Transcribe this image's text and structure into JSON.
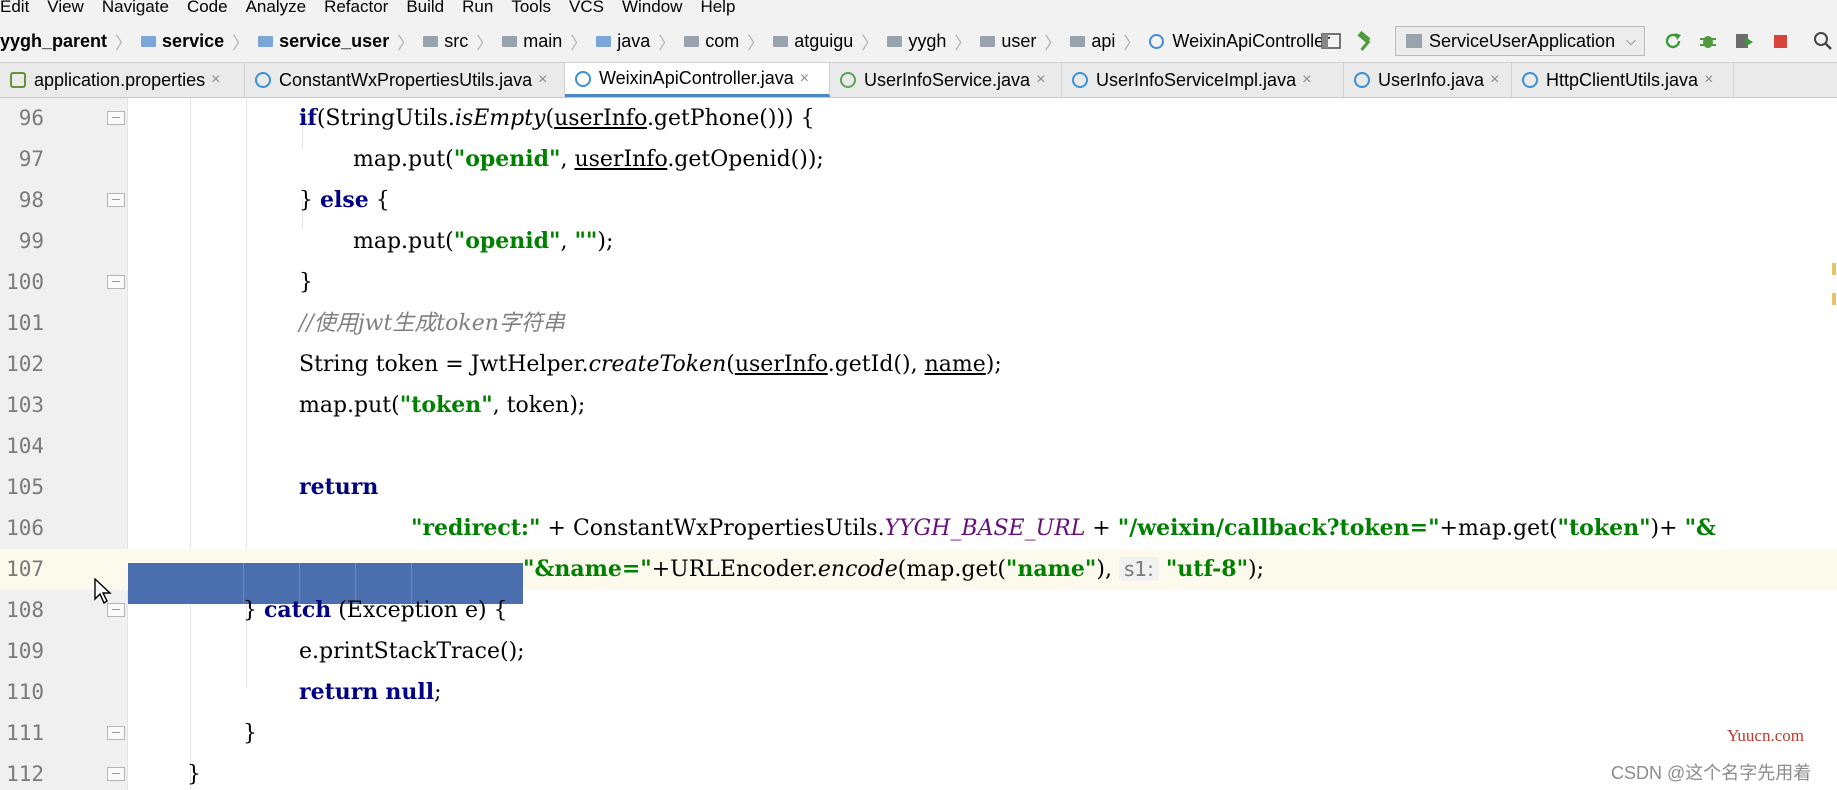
{
  "menu": {
    "items": [
      "Edit",
      "View",
      "Navigate",
      "Code",
      "Analyze",
      "Refactor",
      "Build",
      "Run",
      "Tools",
      "VCS",
      "Window",
      "Help"
    ]
  },
  "breadcrumbs": [
    {
      "label": "yygh_parent",
      "icon": "project-folder-icon",
      "bold": true
    },
    {
      "label": "service",
      "icon": "module-folder-icon",
      "bold": true
    },
    {
      "label": "service_user",
      "icon": "module-folder-icon",
      "bold": true
    },
    {
      "label": "src",
      "icon": "folder-icon",
      "bold": false
    },
    {
      "label": "main",
      "icon": "folder-icon",
      "bold": false
    },
    {
      "label": "java",
      "icon": "source-folder-icon",
      "bold": false
    },
    {
      "label": "com",
      "icon": "package-icon",
      "bold": false
    },
    {
      "label": "atguigu",
      "icon": "package-icon",
      "bold": false
    },
    {
      "label": "yygh",
      "icon": "package-icon",
      "bold": false
    },
    {
      "label": "user",
      "icon": "package-icon",
      "bold": false
    },
    {
      "label": "api",
      "icon": "package-icon",
      "bold": false
    },
    {
      "label": "WeixinApiController",
      "icon": "class-icon",
      "bold": false
    }
  ],
  "toolbar": {
    "run_config": "ServiceUserApplication"
  },
  "tabs": [
    {
      "label": "application.properties",
      "icon": "properties-file-icon",
      "active": false
    },
    {
      "label": "ConstantWxPropertiesUtils.java",
      "icon": "class-icon",
      "active": false
    },
    {
      "label": "WeixinApiController.java",
      "icon": "class-icon",
      "active": true
    },
    {
      "label": "UserInfoService.java",
      "icon": "interface-icon",
      "active": false
    },
    {
      "label": "UserInfoServiceImpl.java",
      "icon": "class-icon",
      "active": false
    },
    {
      "label": "UserInfo.java",
      "icon": "class-icon",
      "active": false
    },
    {
      "label": "HttpClientUtils.java",
      "icon": "class-icon",
      "active": false
    }
  ],
  "tab_close_glyph": "×",
  "code_lines": [
    {
      "n": "96",
      "text": "if(StringUtils.isEmpty(userInfo.getPhone())) {"
    },
    {
      "n": "97",
      "text": "map.put(\"openid\", userInfo.getOpenid());"
    },
    {
      "n": "98",
      "text": "} else {"
    },
    {
      "n": "99",
      "text": "map.put(\"openid\", \"\");"
    },
    {
      "n": "100",
      "text": "}"
    },
    {
      "n": "101",
      "text": "//使用jwt生成token字符串"
    },
    {
      "n": "102",
      "text": "String token = JwtHelper.createToken(userInfo.getId(), name);"
    },
    {
      "n": "103",
      "text": "map.put(\"token\", token);"
    },
    {
      "n": "104",
      "text": ""
    },
    {
      "n": "105",
      "text": "return"
    },
    {
      "n": "106",
      "text": "\"redirect:\" + ConstantWxPropertiesUtils.YYGH_BASE_URL + \"/weixin/callback?token=\"+map.get(\"token\")+ \"&"
    },
    {
      "n": "107",
      "text": "\"&name=\"+URLEncoder.encode(map.get(\"name\"), s1: \"utf-8\");"
    },
    {
      "n": "108",
      "text": "} catch (Exception e) {"
    },
    {
      "n": "109",
      "text": "e.printStackTrace();"
    },
    {
      "n": "110",
      "text": "return null;"
    },
    {
      "n": "111",
      "text": "}"
    },
    {
      "n": "112",
      "text": "}"
    }
  ],
  "watermarks": {
    "site": "Yuucn.com",
    "author": "CSDN @这个名字先用着"
  },
  "colors": {
    "keyword": "#000080",
    "string": "#008000",
    "comment": "#808080",
    "constant": "#660e7a",
    "selection": "#4b6eaf",
    "current_line": "#fcfaed",
    "active_tab_underline": "#4a88c7"
  }
}
